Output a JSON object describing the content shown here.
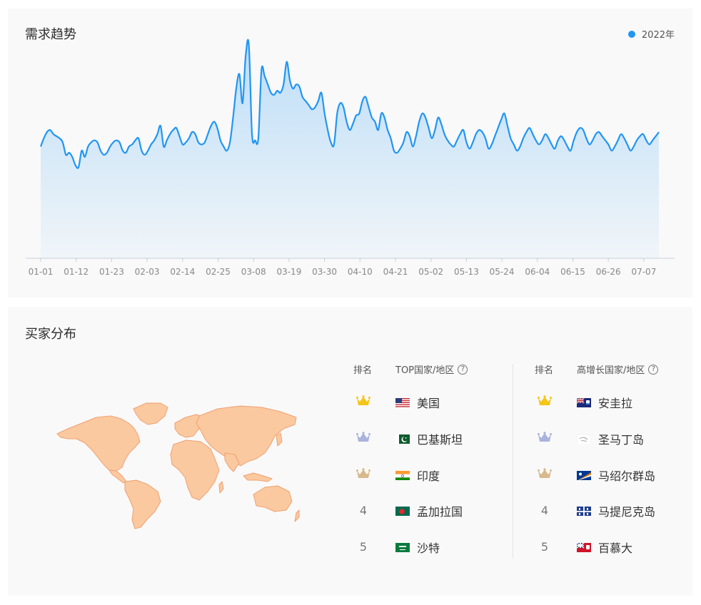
{
  "trend": {
    "title": "需求趋势",
    "legend_label": "2022年",
    "accent": "#2196f3"
  },
  "chart_data": {
    "type": "area",
    "title": "需求趋势",
    "series": [
      {
        "name": "2022年",
        "color": "#2196f3"
      }
    ],
    "x_tick_labels": [
      "01-01",
      "01-12",
      "01-23",
      "02-03",
      "02-14",
      "02-25",
      "03-08",
      "03-19",
      "03-30",
      "04-10",
      "04-21",
      "05-02",
      "05-13",
      "05-24",
      "06-04",
      "06-15",
      "06-26",
      "07-07"
    ],
    "x_range": [
      0,
      196
    ],
    "ylim": [
      0,
      100
    ],
    "grid": false,
    "legend": "top-right",
    "points": [
      [
        0,
        54
      ],
      [
        1,
        58
      ],
      [
        2,
        61
      ],
      [
        3,
        62
      ],
      [
        4,
        60
      ],
      [
        5,
        59
      ],
      [
        6,
        58
      ],
      [
        7,
        56
      ],
      [
        8,
        50
      ],
      [
        9,
        51
      ],
      [
        10,
        49
      ],
      [
        11,
        45
      ],
      [
        12,
        44
      ],
      [
        13,
        52
      ],
      [
        14,
        49
      ],
      [
        15,
        54
      ],
      [
        16,
        56
      ],
      [
        17,
        57
      ],
      [
        18,
        56
      ],
      [
        19,
        52
      ],
      [
        20,
        50
      ],
      [
        21,
        51
      ],
      [
        22,
        54
      ],
      [
        23,
        56
      ],
      [
        24,
        57
      ],
      [
        25,
        56
      ],
      [
        26,
        52
      ],
      [
        27,
        51
      ],
      [
        28,
        54
      ],
      [
        29,
        55
      ],
      [
        30,
        57
      ],
      [
        31,
        58
      ],
      [
        32,
        52
      ],
      [
        33,
        50
      ],
      [
        34,
        52
      ],
      [
        35,
        55
      ],
      [
        36,
        57
      ],
      [
        37,
        60
      ],
      [
        38,
        64
      ],
      [
        39,
        54
      ],
      [
        40,
        57
      ],
      [
        41,
        60
      ],
      [
        42,
        62
      ],
      [
        43,
        63
      ],
      [
        44,
        59
      ],
      [
        45,
        55
      ],
      [
        46,
        56
      ],
      [
        47,
        58
      ],
      [
        48,
        61
      ],
      [
        49,
        60
      ],
      [
        50,
        56
      ],
      [
        51,
        55
      ],
      [
        52,
        56
      ],
      [
        53,
        60
      ],
      [
        54,
        64
      ],
      [
        55,
        66
      ],
      [
        56,
        63
      ],
      [
        57,
        57
      ],
      [
        58,
        54
      ],
      [
        59,
        52
      ],
      [
        60,
        56
      ],
      [
        61,
        68
      ],
      [
        62,
        82
      ],
      [
        63,
        89
      ],
      [
        64,
        75
      ],
      [
        65,
        98
      ],
      [
        66,
        103
      ],
      [
        67,
        60
      ],
      [
        68,
        57
      ],
      [
        69,
        58
      ],
      [
        70,
        91
      ],
      [
        71,
        88
      ],
      [
        72,
        84
      ],
      [
        73,
        80
      ],
      [
        74,
        79
      ],
      [
        75,
        81
      ],
      [
        76,
        80
      ],
      [
        77,
        84
      ],
      [
        78,
        95
      ],
      [
        79,
        86
      ],
      [
        80,
        82
      ],
      [
        81,
        84
      ],
      [
        82,
        83
      ],
      [
        83,
        78
      ],
      [
        84,
        76
      ],
      [
        85,
        74
      ],
      [
        86,
        72
      ],
      [
        87,
        73
      ],
      [
        88,
        76
      ],
      [
        89,
        80
      ],
      [
        90,
        70
      ],
      [
        91,
        62
      ],
      [
        92,
        56
      ],
      [
        93,
        55
      ],
      [
        94,
        70
      ],
      [
        95,
        75
      ],
      [
        96,
        73
      ],
      [
        97,
        66
      ],
      [
        98,
        62
      ],
      [
        99,
        65
      ],
      [
        100,
        69
      ],
      [
        101,
        70
      ],
      [
        102,
        76
      ],
      [
        103,
        78
      ],
      [
        104,
        73
      ],
      [
        105,
        68
      ],
      [
        106,
        66
      ],
      [
        107,
        62
      ],
      [
        108,
        70
      ],
      [
        109,
        68
      ],
      [
        110,
        62
      ],
      [
        111,
        58
      ],
      [
        112,
        52
      ],
      [
        113,
        51
      ],
      [
        114,
        53
      ],
      [
        115,
        56
      ],
      [
        116,
        61
      ],
      [
        117,
        59
      ],
      [
        118,
        54
      ],
      [
        119,
        59
      ],
      [
        120,
        66
      ],
      [
        121,
        70
      ],
      [
        122,
        68
      ],
      [
        123,
        63
      ],
      [
        124,
        58
      ],
      [
        125,
        62
      ],
      [
        126,
        68
      ],
      [
        127,
        65
      ],
      [
        128,
        60
      ],
      [
        129,
        57
      ],
      [
        130,
        55
      ],
      [
        131,
        54
      ],
      [
        132,
        57
      ],
      [
        133,
        60
      ],
      [
        134,
        62
      ],
      [
        135,
        56
      ],
      [
        136,
        53
      ],
      [
        137,
        56
      ],
      [
        138,
        60
      ],
      [
        139,
        62
      ],
      [
        140,
        61
      ],
      [
        141,
        58
      ],
      [
        142,
        53
      ],
      [
        143,
        55
      ],
      [
        144,
        59
      ],
      [
        145,
        63
      ],
      [
        146,
        67
      ],
      [
        147,
        70
      ],
      [
        148,
        64
      ],
      [
        149,
        58
      ],
      [
        150,
        55
      ],
      [
        151,
        52
      ],
      [
        152,
        54
      ],
      [
        153,
        58
      ],
      [
        154,
        61
      ],
      [
        155,
        63
      ],
      [
        156,
        60
      ],
      [
        157,
        57
      ],
      [
        158,
        55
      ],
      [
        159,
        57
      ],
      [
        160,
        60
      ],
      [
        161,
        58
      ],
      [
        162,
        55
      ],
      [
        163,
        53
      ],
      [
        164,
        57
      ],
      [
        165,
        59
      ],
      [
        166,
        57
      ],
      [
        167,
        54
      ],
      [
        168,
        52
      ],
      [
        169,
        57
      ],
      [
        170,
        61
      ],
      [
        171,
        63
      ],
      [
        172,
        62
      ],
      [
        173,
        58
      ],
      [
        174,
        55
      ],
      [
        175,
        57
      ],
      [
        176,
        60
      ],
      [
        177,
        61
      ],
      [
        178,
        59
      ],
      [
        179,
        57
      ],
      [
        180,
        55
      ],
      [
        181,
        52
      ],
      [
        182,
        54
      ],
      [
        183,
        57
      ],
      [
        184,
        60
      ],
      [
        185,
        58
      ],
      [
        186,
        55
      ],
      [
        187,
        52
      ],
      [
        188,
        54
      ],
      [
        189,
        57
      ],
      [
        190,
        59
      ],
      [
        191,
        60
      ],
      [
        192,
        57
      ],
      [
        193,
        55
      ],
      [
        194,
        57
      ],
      [
        195,
        59
      ],
      [
        196,
        61
      ]
    ]
  },
  "buyers": {
    "title": "买家分布",
    "left_table": {
      "rank_header": "排名",
      "country_header": "TOP国家/地区",
      "rows": [
        {
          "rank": "",
          "crown": "gold",
          "country": "美国",
          "flag": "us"
        },
        {
          "rank": "",
          "crown": "silver",
          "country": "巴基斯坦",
          "flag": "pk"
        },
        {
          "rank": "",
          "crown": "bronze",
          "country": "印度",
          "flag": "in"
        },
        {
          "rank": "4",
          "crown": "",
          "country": "孟加拉国",
          "flag": "bd"
        },
        {
          "rank": "5",
          "crown": "",
          "country": "沙特",
          "flag": "sa"
        }
      ]
    },
    "right_table": {
      "rank_header": "排名",
      "country_header": "高增长国家/地区",
      "rows": [
        {
          "rank": "",
          "crown": "gold",
          "country": "安圭拉",
          "flag": "ai"
        },
        {
          "rank": "",
          "crown": "silver",
          "country": "圣马丁岛",
          "flag": "mf"
        },
        {
          "rank": "",
          "crown": "bronze",
          "country": "马绍尔群岛",
          "flag": "mh"
        },
        {
          "rank": "4",
          "crown": "",
          "country": "马提尼克岛",
          "flag": "mq"
        },
        {
          "rank": "5",
          "crown": "",
          "country": "百慕大",
          "flag": "bm"
        }
      ]
    },
    "crown_colors": {
      "gold": "#f5c518",
      "silver": "#aab3dc",
      "bronze": "#d7b98c"
    },
    "map_fill": "#fbc9a0",
    "map_stroke": "#f0a070"
  }
}
